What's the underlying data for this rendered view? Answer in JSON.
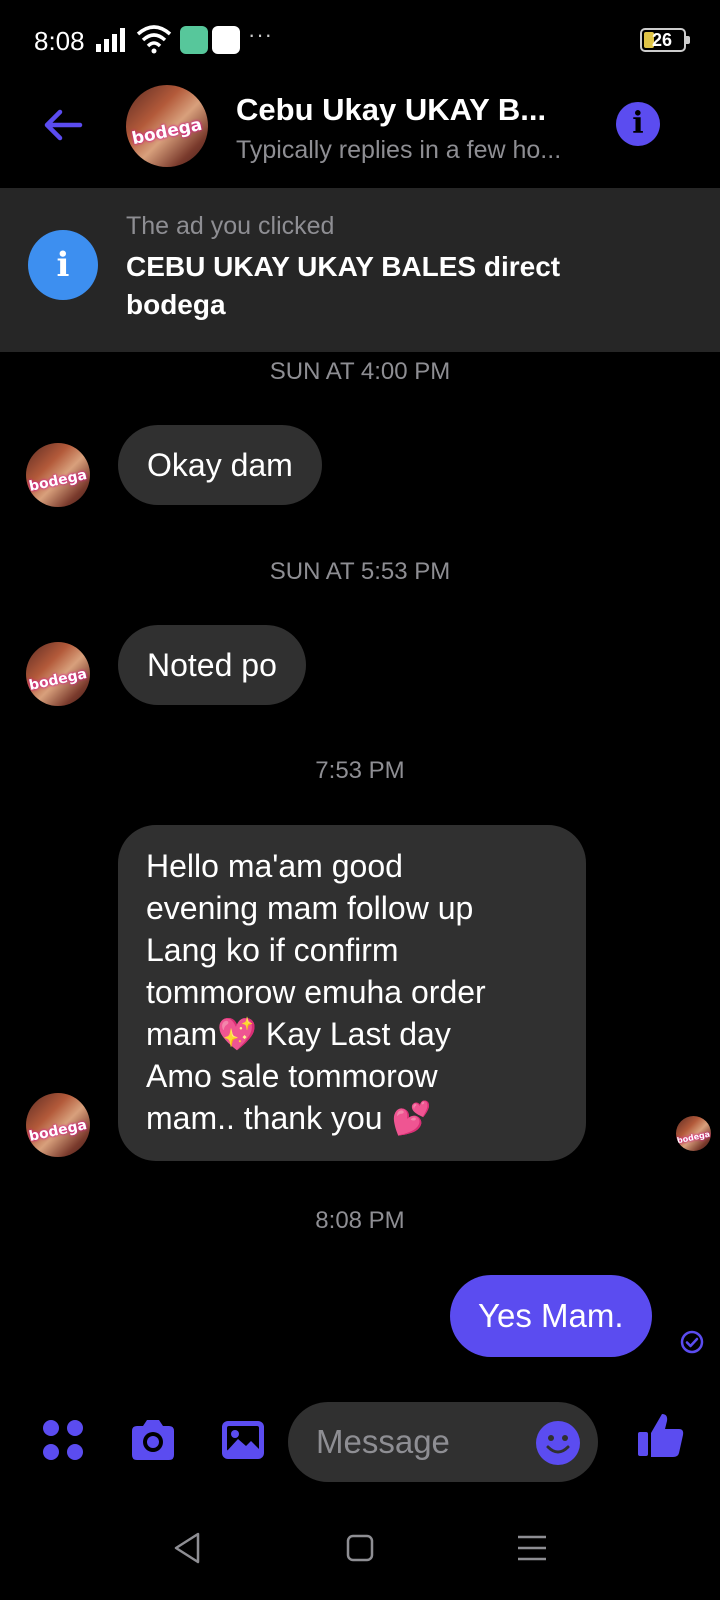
{
  "status_bar": {
    "time": "8:08",
    "more_indicator": "···",
    "battery_level": "26",
    "icons": [
      "signal-icon",
      "wifi-icon",
      "app-badge-icon",
      "app-badge-icon",
      "battery-icon"
    ]
  },
  "header": {
    "contact_name": "Cebu Ukay UKAY B...",
    "contact_status": "Typically replies in a few ho...",
    "avatar_text": "bodega",
    "info_label": "i"
  },
  "ad_banner": {
    "icon_label": "i",
    "caption": "The ad you clicked",
    "title": "CEBU UKAY UKAY BALES direct bodega"
  },
  "messages": [
    {
      "type": "timestamp",
      "text": "SUN AT 4:00 PM"
    },
    {
      "type": "incoming",
      "text": "Okay dam"
    },
    {
      "type": "timestamp",
      "text": "SUN AT 5:53 PM"
    },
    {
      "type": "incoming",
      "text": "Noted po"
    },
    {
      "type": "timestamp",
      "text": "7:53 PM"
    },
    {
      "type": "incoming",
      "lines": [
        "Hello ma'am good",
        "evening mam follow up",
        "Lang ko if confirm",
        "tommorow emuha order",
        "mam💖 Kay Last day",
        "Amo sale tommorow",
        "mam.. thank you 💕"
      ]
    },
    {
      "type": "timestamp",
      "text": "8:08 PM"
    },
    {
      "type": "outgoing",
      "text": "Yes Mam."
    }
  ],
  "composer": {
    "placeholder": "Message",
    "icons": [
      "apps-icon",
      "camera-icon",
      "gallery-icon",
      "emoji-icon",
      "thumbs-up-icon"
    ]
  },
  "nav_bar": {
    "icons": [
      "back-triangle-icon",
      "home-square-icon",
      "recents-menu-icon"
    ]
  },
  "colors": {
    "accent": "#5b4cf0",
    "bubble_incoming": "#303030",
    "ad_banner": "#262626",
    "muted_text": "#8e8e93",
    "ad_icon": "#3d8ff0"
  }
}
